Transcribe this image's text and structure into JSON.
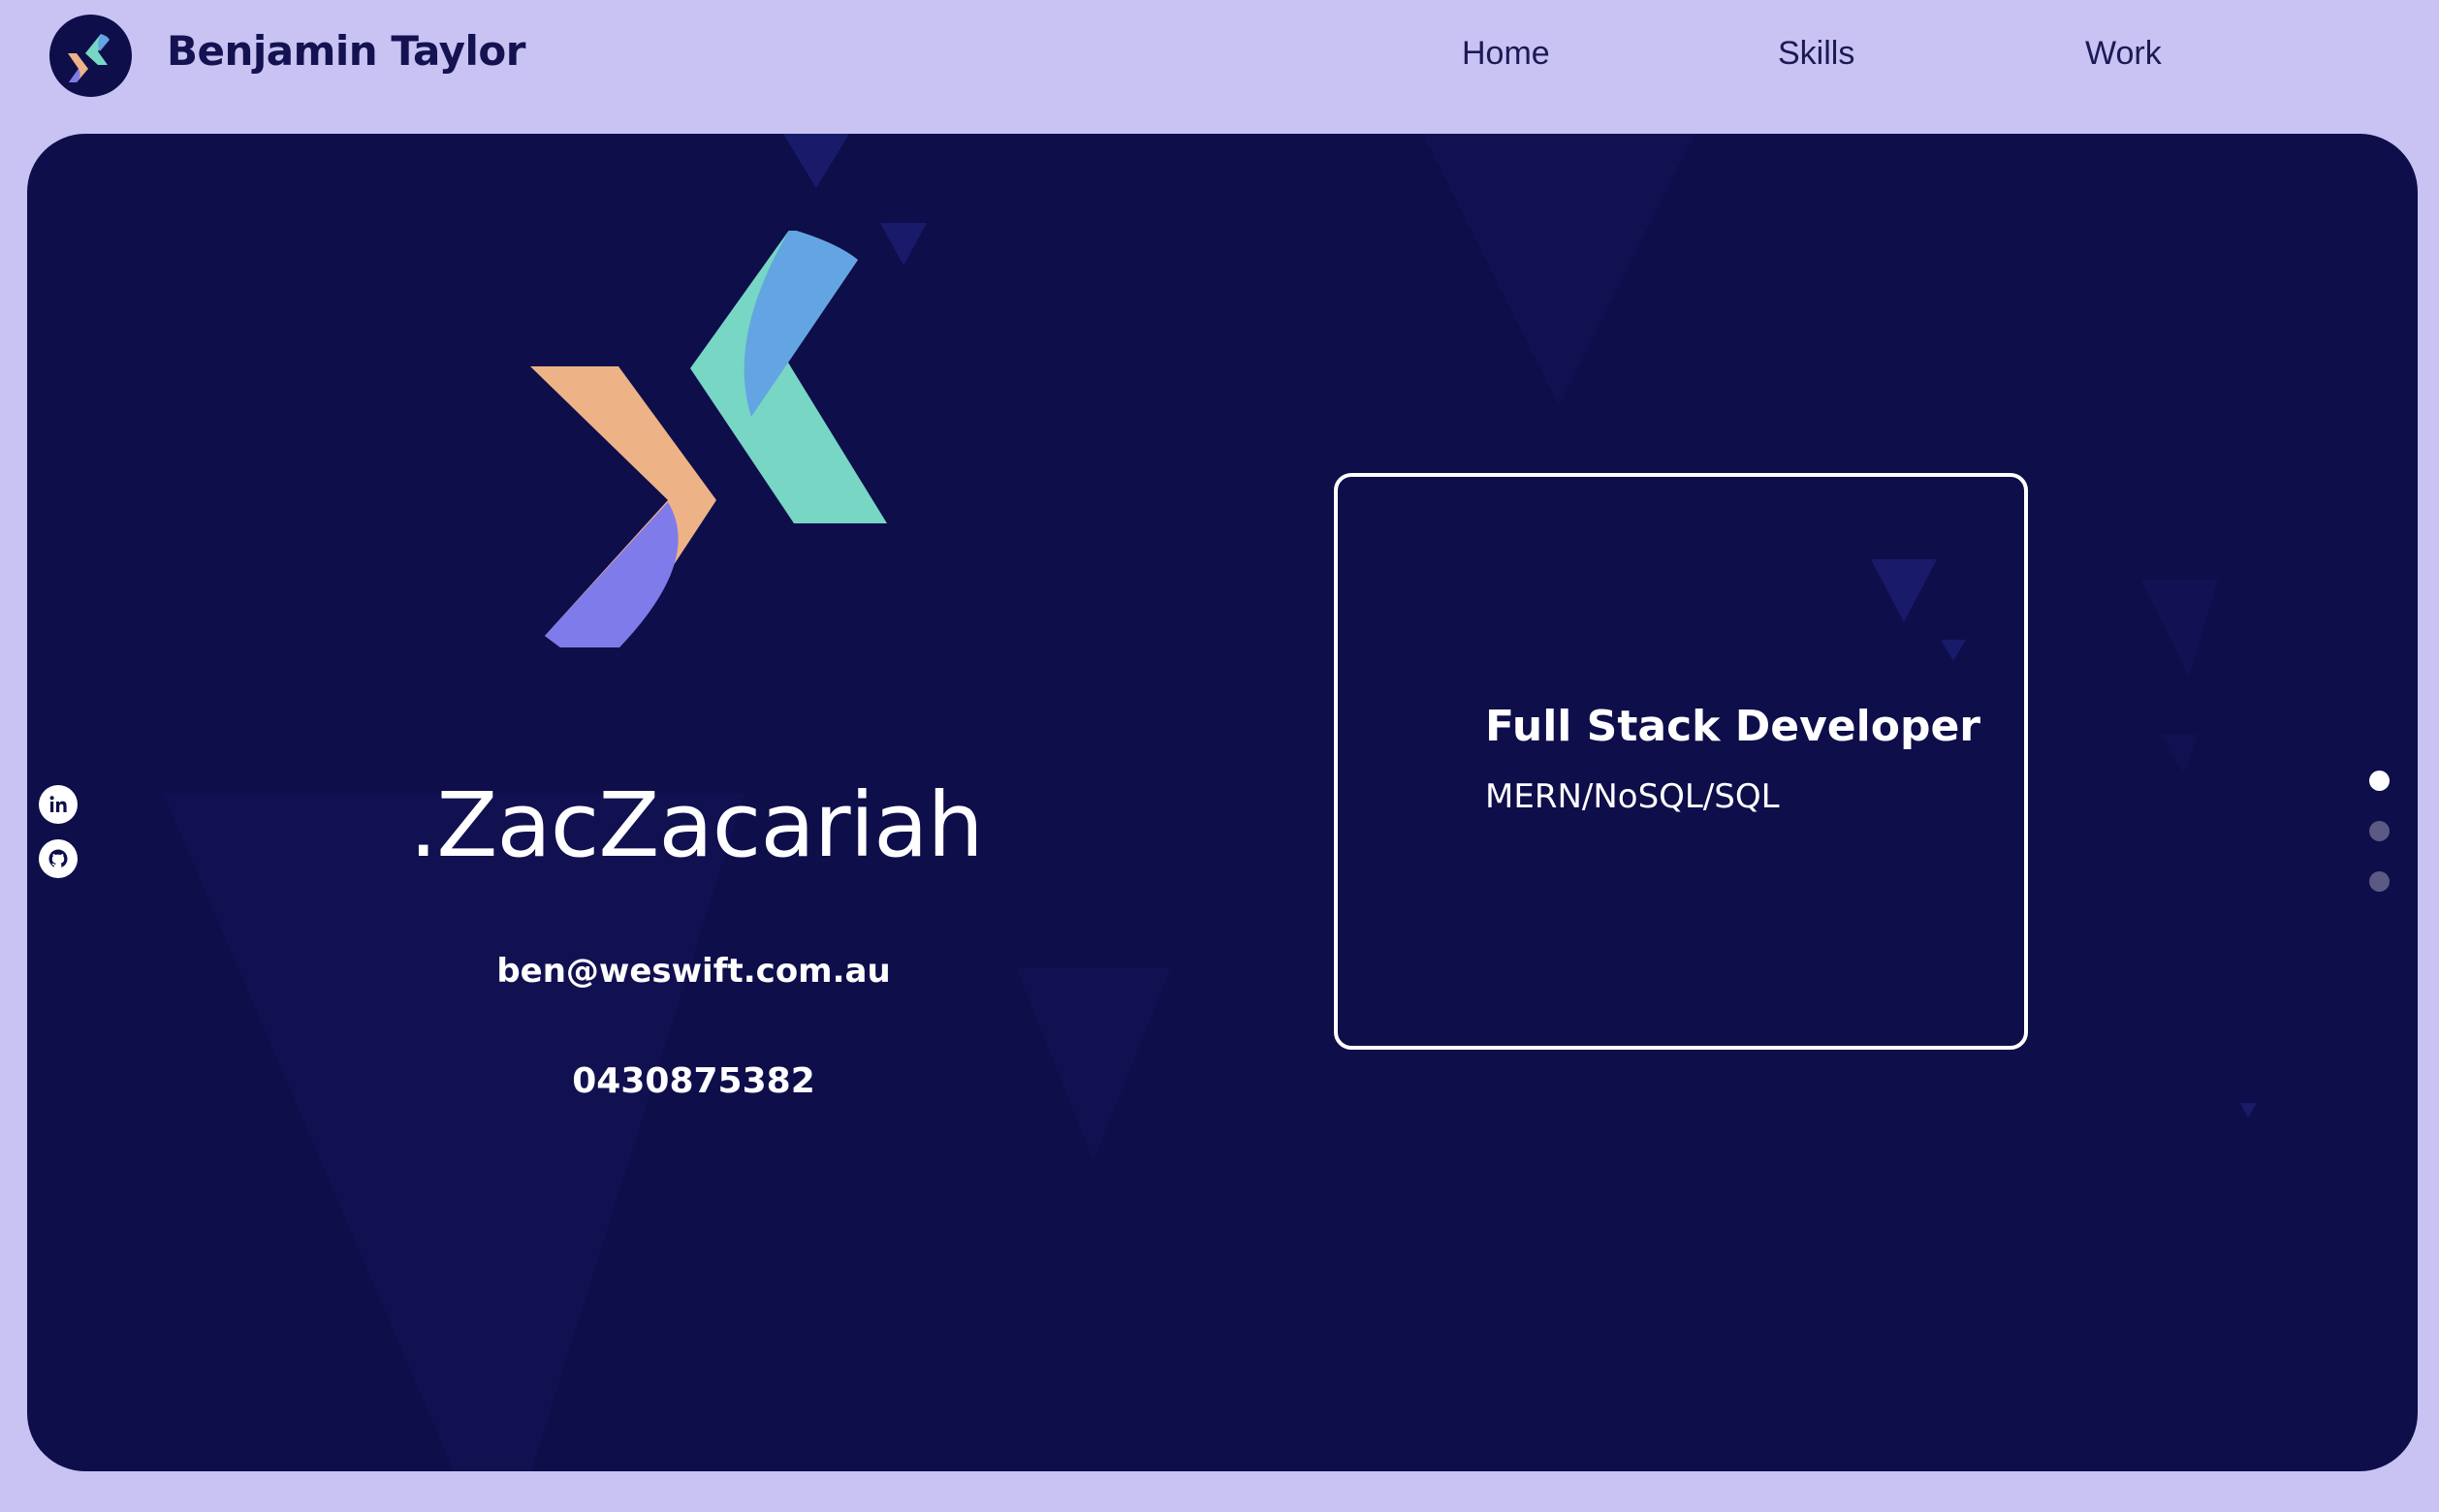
{
  "header": {
    "brand_name": "Benjamin Taylor",
    "logo_icon": "zz-logo-icon",
    "nav": [
      {
        "label": "Home"
      },
      {
        "label": "Skills"
      },
      {
        "label": "Work"
      }
    ]
  },
  "hero": {
    "handle": ".ZacZacariah",
    "email": "ben@weswift.com.au",
    "phone": "0430875382",
    "role_card": {
      "title": "Full Stack Developer",
      "stack": "MERN/NoSQL/SQL"
    }
  },
  "social": [
    {
      "icon": "linkedin-icon"
    },
    {
      "icon": "github-icon"
    }
  ],
  "pagination": {
    "count": 3,
    "active_index": 0
  },
  "colors": {
    "page_background": "#c8c3f3",
    "hero_background": "#0e0e4b",
    "logo_peach": "#eeb287",
    "logo_mint": "#77d6c4",
    "logo_blue": "#63a5e2",
    "logo_violet": "#7f7bea"
  }
}
